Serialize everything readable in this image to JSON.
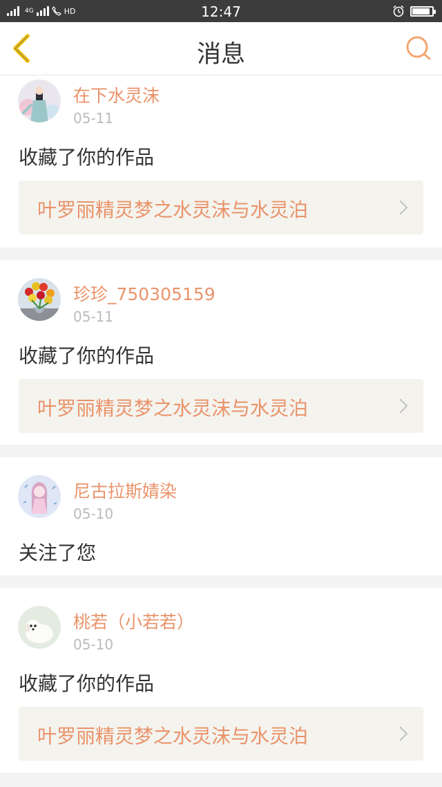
{
  "status_bar": {
    "net_label": "4G",
    "hd_label": "HD",
    "time": "12:47",
    "battery_level": 0.9
  },
  "header": {
    "title": "消息"
  },
  "notifications": [
    {
      "username": "在下水灵沫",
      "date": "05-11",
      "action": "收藏了你的作品",
      "work_title": "叶罗丽精灵梦之水灵沫与水灵泊"
    },
    {
      "username": "珍珍_750305159",
      "date": "05-11",
      "action": "收藏了你的作品",
      "work_title": "叶罗丽精灵梦之水灵沫与水灵泊"
    },
    {
      "username": "尼古拉斯婧染",
      "date": "05-10",
      "action": "关注了您"
    },
    {
      "username": "桃若（小若若）",
      "date": "05-10",
      "action": "收藏了你的作品",
      "work_title": "叶罗丽精灵梦之水灵沫与水灵泊"
    }
  ],
  "colors": {
    "accent": "#e9936a",
    "back_arrow": "#f0c419",
    "search": "#f4a46f",
    "work_bg": "#f4f3ee"
  }
}
